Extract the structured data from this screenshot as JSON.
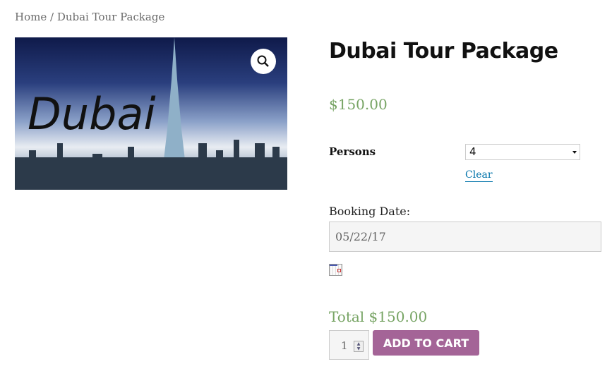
{
  "breadcrumb": {
    "home": "Home",
    "separator": " / ",
    "current": "Dubai Tour Package"
  },
  "product": {
    "title": "Dubai Tour Package",
    "price": "$150.00",
    "image_text": "Dubai",
    "persons_label": "Persons",
    "persons_value": "4",
    "clear_label": "Clear",
    "booking_label": "Booking Date:",
    "booking_value": "05/22/17",
    "total": "Total $150.00",
    "quantity": "1",
    "add_to_cart": "ADD TO CART"
  },
  "colors": {
    "price": "#77a464",
    "button": "#a46497",
    "link": "#0073aa"
  }
}
